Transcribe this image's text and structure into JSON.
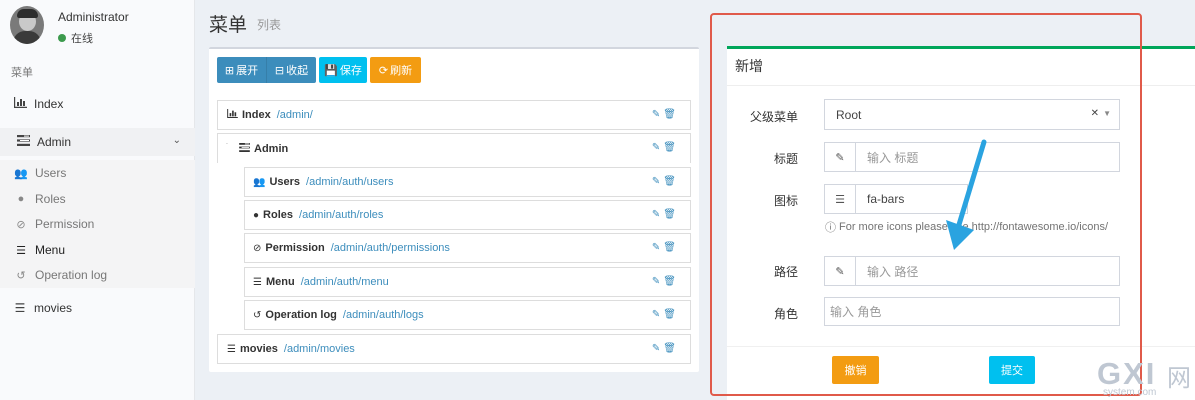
{
  "user": {
    "name": "Administrator",
    "status": "在线"
  },
  "sidebar": {
    "header": "菜单",
    "items": [
      {
        "label": "Index",
        "icon": "bar-chart-icon"
      },
      {
        "label": "Admin",
        "icon": "tasks-icon"
      },
      {
        "label": "movies",
        "icon": "bars-icon"
      }
    ],
    "sub_items": [
      {
        "label": "Users",
        "icon": "users-icon"
      },
      {
        "label": "Roles",
        "icon": "user-icon"
      },
      {
        "label": "Permission",
        "icon": "ban-icon"
      },
      {
        "label": "Menu",
        "icon": "bars-icon"
      },
      {
        "label": "Operation log",
        "icon": "history-icon"
      }
    ]
  },
  "page": {
    "title": "菜单",
    "subtitle": "列表"
  },
  "toolbar": {
    "expand": "展开",
    "collapse": "收起",
    "save": "保存",
    "refresh": "刷新"
  },
  "tree": [
    {
      "title": "Index",
      "uri": "/admin/",
      "icon": "bar-chart-icon"
    },
    {
      "title": "Admin",
      "uri": "",
      "icon": "tasks-icon"
    },
    {
      "title": "Users",
      "uri": "/admin/auth/users",
      "icon": "users-icon"
    },
    {
      "title": "Roles",
      "uri": "/admin/auth/roles",
      "icon": "user-icon"
    },
    {
      "title": "Permission",
      "uri": "/admin/auth/permissions",
      "icon": "ban-icon"
    },
    {
      "title": "Menu",
      "uri": "/admin/auth/menu",
      "icon": "bars-icon"
    },
    {
      "title": "Operation log",
      "uri": "/admin/auth/logs",
      "icon": "history-icon"
    },
    {
      "title": "movies",
      "uri": "/admin/movies",
      "icon": "bars-icon"
    }
  ],
  "form": {
    "title": "新增",
    "parent_label": "父级菜单",
    "parent_value": "Root",
    "title_label": "标题",
    "title_placeholder": "输入 标题",
    "icon_label": "图标",
    "icon_value": "fa-bars",
    "icon_help": "For more icons please see http://fontawesome.io/icons/",
    "uri_label": "路径",
    "uri_placeholder": "输入 路径",
    "roles_label": "角色",
    "roles_placeholder": "输入 角色",
    "reset": "撤销",
    "submit": "提交"
  },
  "watermark": {
    "brand": "GXI",
    "suffix": "网",
    "domain": "system.com"
  },
  "colors": {
    "primary": "#3c8dbc",
    "info": "#00c0ef",
    "warning": "#f39c12",
    "success": "#00a65a",
    "annotation": "#e05a4a",
    "arrow": "#2aa3e0"
  }
}
